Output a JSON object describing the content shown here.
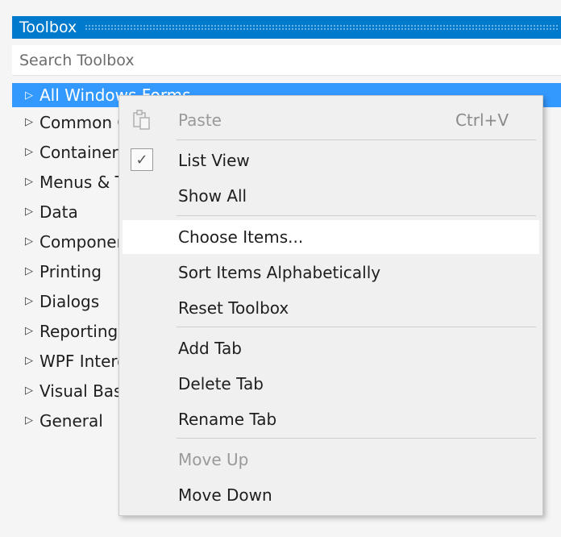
{
  "toolbox": {
    "title": "Toolbox",
    "search_placeholder": "Search Toolbox",
    "items": [
      {
        "label": "All Windows Forms"
      },
      {
        "label": "Common Controls"
      },
      {
        "label": "Containers"
      },
      {
        "label": "Menus & Toolbars"
      },
      {
        "label": "Data"
      },
      {
        "label": "Components"
      },
      {
        "label": "Printing"
      },
      {
        "label": "Dialogs"
      },
      {
        "label": "Reporting"
      },
      {
        "label": "WPF Interoperability"
      },
      {
        "label": "Visual Basic PowerPacks"
      },
      {
        "label": "General"
      }
    ]
  },
  "context_menu": {
    "paste": {
      "label": "Paste",
      "shortcut": "Ctrl+V",
      "icon": "paste-icon",
      "enabled": false
    },
    "list_view": {
      "label": "List View",
      "checked": true
    },
    "show_all": {
      "label": "Show All"
    },
    "choose_items": {
      "label": "Choose Items..."
    },
    "sort_items": {
      "label": "Sort Items Alphabetically"
    },
    "reset_toolbox": {
      "label": "Reset Toolbox"
    },
    "add_tab": {
      "label": "Add Tab"
    },
    "delete_tab": {
      "label": "Delete Tab"
    },
    "rename_tab": {
      "label": "Rename Tab"
    },
    "move_up": {
      "label": "Move Up",
      "enabled": false
    },
    "move_down": {
      "label": "Move Down"
    },
    "check_glyph": "✓"
  },
  "colors": {
    "accent": "#007acc",
    "selection": "#3399ff",
    "menu_bg": "#f0f0f0"
  }
}
